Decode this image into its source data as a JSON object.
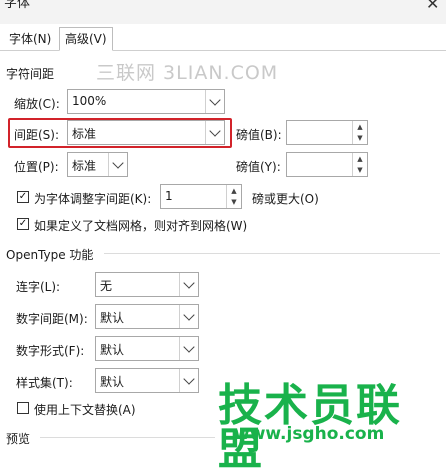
{
  "window": {
    "title": "字体",
    "close_glyph": "✕"
  },
  "tabs": [
    {
      "label": "字体(N)",
      "selected": false
    },
    {
      "label": "高级(V)",
      "selected": true
    }
  ],
  "char_spacing": {
    "section_title": "字符间距",
    "scale": {
      "label": "缩放(C):",
      "value": "100%"
    },
    "spacing": {
      "label": "间距(S):",
      "value": "标准",
      "pt_label": "磅值(B):",
      "pt_value": ""
    },
    "position": {
      "label": "位置(P):",
      "value": "标准",
      "pt_label": "磅值(Y):",
      "pt_value": ""
    },
    "kerning": {
      "checked": true,
      "label": "为字体调整字间距(K):",
      "value": "1",
      "suffix": "磅或更大(O)"
    },
    "grid": {
      "checked": true,
      "label": "如果定义了文档网格，则对齐到网格(W)"
    }
  },
  "opentype": {
    "section_title": "OpenType 功能",
    "ligatures": {
      "label": "连字(L):",
      "value": "无"
    },
    "num_spacing": {
      "label": "数字间距(M):",
      "value": "默认"
    },
    "num_forms": {
      "label": "数字形式(F):",
      "value": "默认"
    },
    "stylistic_sets": {
      "label": "样式集(T):",
      "value": "默认"
    },
    "contextual": {
      "checked": false,
      "label": "使用上下文替换(A)"
    }
  },
  "preview": {
    "section_title": "预览"
  },
  "watermarks": {
    "sanlian": "三联网 3LIAN.COM",
    "logo_text": "技术员联盟",
    "logo_url": "www.jsgho.com"
  },
  "colors": {
    "highlight_border": "#d2232a",
    "logo_green": "#19b24b"
  },
  "check_glyph": "✓"
}
